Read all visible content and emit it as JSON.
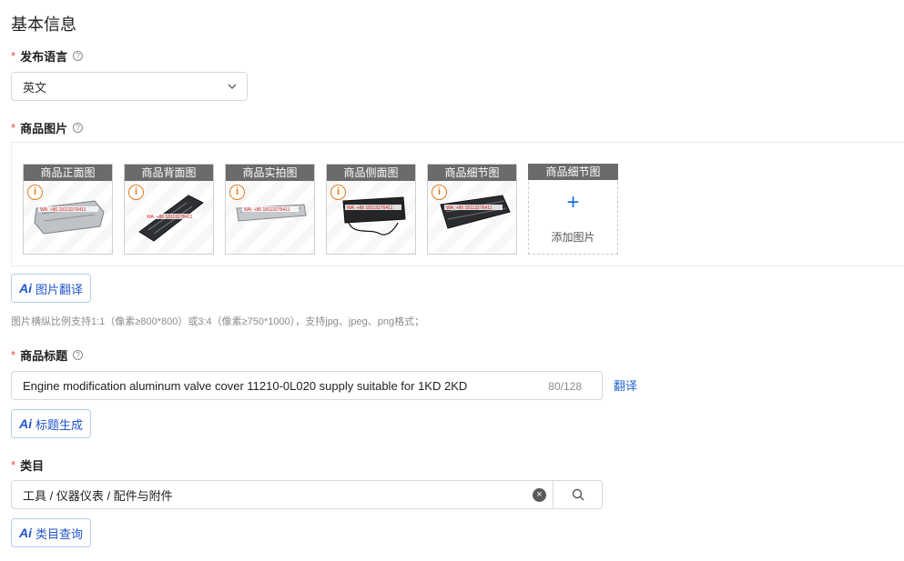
{
  "section": {
    "title": "基本信息"
  },
  "language": {
    "label": "发布语言",
    "required_mark": "*",
    "help_icon": "question-circle-icon",
    "selected": "英文"
  },
  "images": {
    "label": "商品图片",
    "required_mark": "*",
    "cards": [
      {
        "caption": "商品正面图",
        "watermark": "WA: +86 18113276411"
      },
      {
        "caption": "商品背面图",
        "watermark": "WA: +86 18113276411"
      },
      {
        "caption": "商品实拍图",
        "watermark": "WA: +86 18113276411"
      },
      {
        "caption": "商品侧面图",
        "watermark": "WA: +86 18113276411"
      },
      {
        "caption": "商品细节图",
        "watermark": "WA: +86 18113276411"
      }
    ],
    "add_card": {
      "caption": "商品细节图",
      "plus": "+",
      "label": "添加图片"
    },
    "ai_button": {
      "prefix": "Ai",
      "label": "图片翻译"
    },
    "hint": "图片横纵比例支持1:1（像素≥800*800）或3:4（像素≥750*1000），支持jpg、jpeg、png格式；"
  },
  "title_field": {
    "label": "商品标题",
    "required_mark": "*",
    "value": "Engine modification aluminum valve cover 11210-0L020 supply suitable for 1KD 2KD",
    "counter": "80/128",
    "translate_link": "翻译",
    "ai_button": {
      "prefix": "Ai",
      "label": "标题生成"
    }
  },
  "category": {
    "label": "类目",
    "required_mark": "*",
    "value": "工具 / 仪器仪表 / 配件与附件",
    "clear_icon": "clear-circle-icon",
    "search_icon": "search-icon",
    "ai_button": {
      "prefix": "Ai",
      "label": "类目查询"
    }
  },
  "colors": {
    "accent": "#2456c9",
    "required": "#e5484d",
    "link": "#2166cc",
    "warning": "#e07a1f"
  }
}
